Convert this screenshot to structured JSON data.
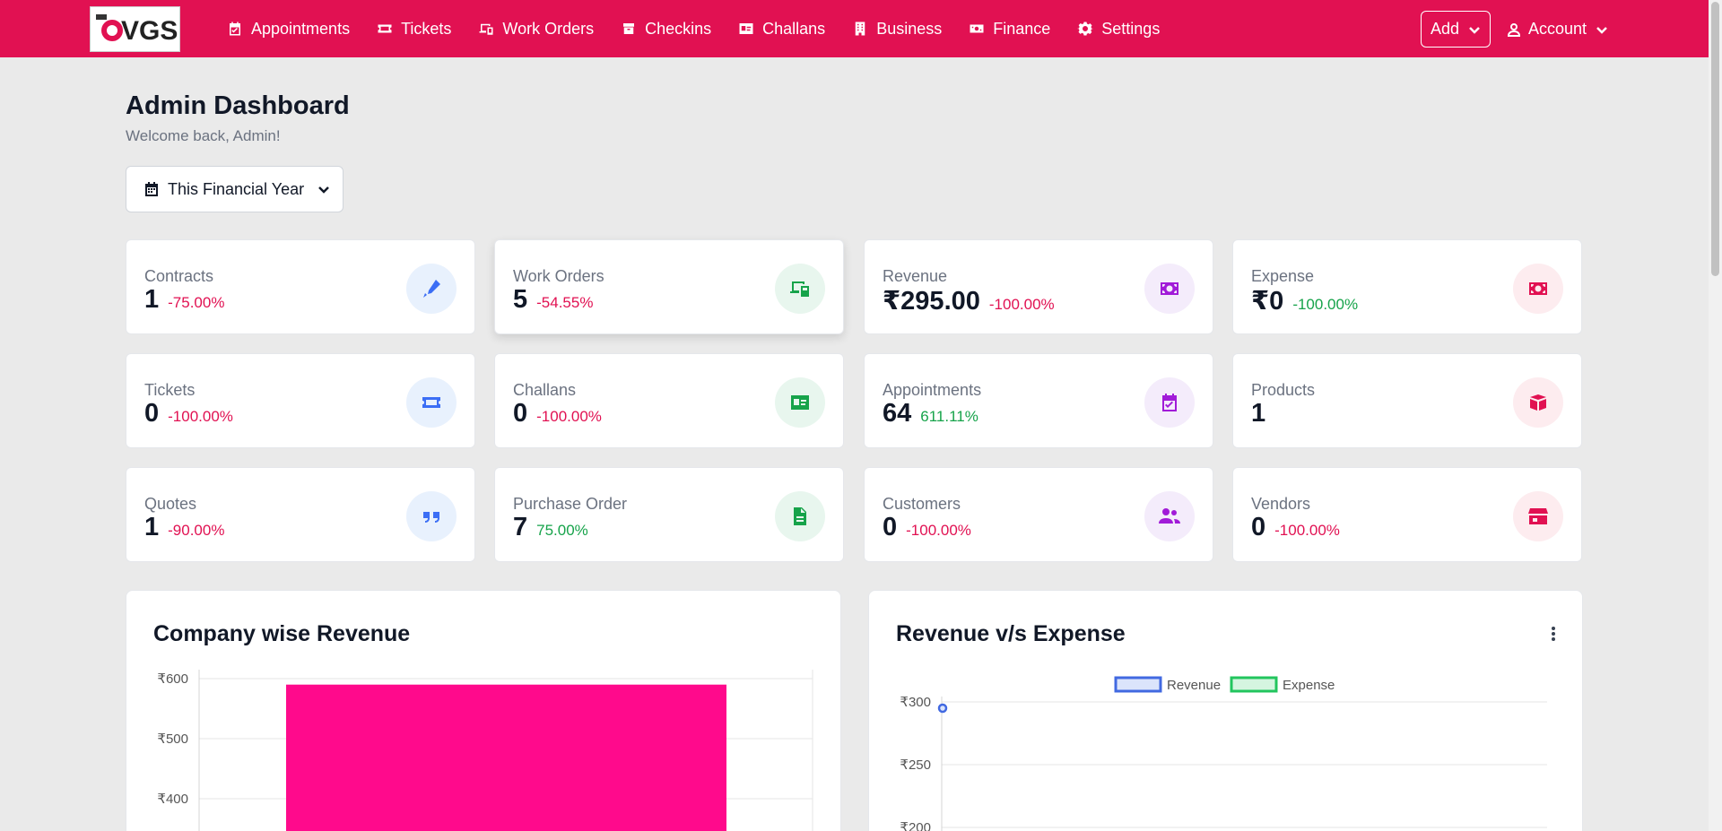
{
  "nav": {
    "logo_text": "VGS",
    "items": [
      {
        "label": "Appointments",
        "icon": "calendar-check-icon"
      },
      {
        "label": "Tickets",
        "icon": "ticket-icon"
      },
      {
        "label": "Work Orders",
        "icon": "devices-icon"
      },
      {
        "label": "Checkins",
        "icon": "box-icon"
      },
      {
        "label": "Challans",
        "icon": "id-card-icon"
      },
      {
        "label": "Business",
        "icon": "building-icon"
      },
      {
        "label": "Finance",
        "icon": "money-icon"
      },
      {
        "label": "Settings",
        "icon": "gear-icon"
      }
    ],
    "add_label": "Add",
    "account_label": "Account"
  },
  "header": {
    "title": "Admin Dashboard",
    "subtitle": "Welcome back, Admin!",
    "period_label": "This Financial Year"
  },
  "colors": {
    "brand": "#e11152",
    "negative": "#e11152",
    "positive": "#16a34a",
    "bar": "#ff0a8c",
    "revenue": "#4169e1",
    "expense": "#22c55e"
  },
  "stats": [
    {
      "label": "Contracts",
      "value": "1",
      "change": "-75.00%",
      "trend": "neg",
      "icon": "pen-icon"
    },
    {
      "label": "Work Orders",
      "value": "5",
      "change": "-54.55%",
      "trend": "neg",
      "icon": "devices-icon"
    },
    {
      "label": "Revenue",
      "value": "₹295.00",
      "change": "-100.00%",
      "trend": "neg",
      "icon": "money-bill-icon"
    },
    {
      "label": "Expense",
      "value": "₹0",
      "change": "-100.00%",
      "trend": "pos",
      "icon": "money-bill-icon"
    },
    {
      "label": "Tickets",
      "value": "0",
      "change": "-100.00%",
      "trend": "neg",
      "icon": "ticket-icon"
    },
    {
      "label": "Challans",
      "value": "0",
      "change": "-100.00%",
      "trend": "neg",
      "icon": "id-card-icon"
    },
    {
      "label": "Appointments",
      "value": "64",
      "change": "611.11%",
      "trend": "pos",
      "icon": "calendar-check-icon"
    },
    {
      "label": "Products",
      "value": "1",
      "change": "",
      "trend": "pos",
      "icon": "box-open-icon"
    },
    {
      "label": "Quotes",
      "value": "1",
      "change": "-90.00%",
      "trend": "neg",
      "icon": "quote-icon"
    },
    {
      "label": "Purchase Order",
      "value": "7",
      "change": "75.00%",
      "trend": "pos",
      "icon": "file-icon"
    },
    {
      "label": "Customers",
      "value": "0",
      "change": "-100.00%",
      "trend": "neg",
      "icon": "users-icon"
    },
    {
      "label": "Vendors",
      "value": "0",
      "change": "-100.00%",
      "trend": "neg",
      "icon": "store-icon"
    }
  ],
  "chart_data": [
    {
      "type": "bar",
      "title": "Company wise Revenue",
      "categories": [
        ""
      ],
      "values": [
        590
      ],
      "y_tick_labels": [
        "₹600",
        "₹500",
        "₹400"
      ],
      "ylim_visible": [
        375,
        600
      ],
      "grid": true
    },
    {
      "type": "line",
      "title": "Revenue v/s Expense",
      "series": [
        {
          "name": "Revenue",
          "values": [
            295
          ]
        },
        {
          "name": "Expense",
          "values": []
        }
      ],
      "y_tick_labels": [
        "₹300",
        "₹250",
        "₹200"
      ],
      "ylim_visible": [
        190,
        300
      ],
      "legend": "top-center",
      "grid": true
    }
  ]
}
